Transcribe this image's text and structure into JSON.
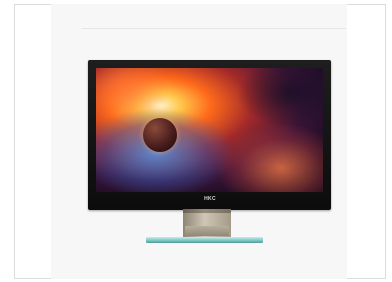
{
  "product": {
    "image_subject": "monitor-photo",
    "brand_text": "HKC"
  },
  "colors": {
    "bezel": "#111111",
    "stand": "#bdb4a2",
    "base_glass": "#8fd0cc",
    "frame_border": "#dcdcdc"
  }
}
